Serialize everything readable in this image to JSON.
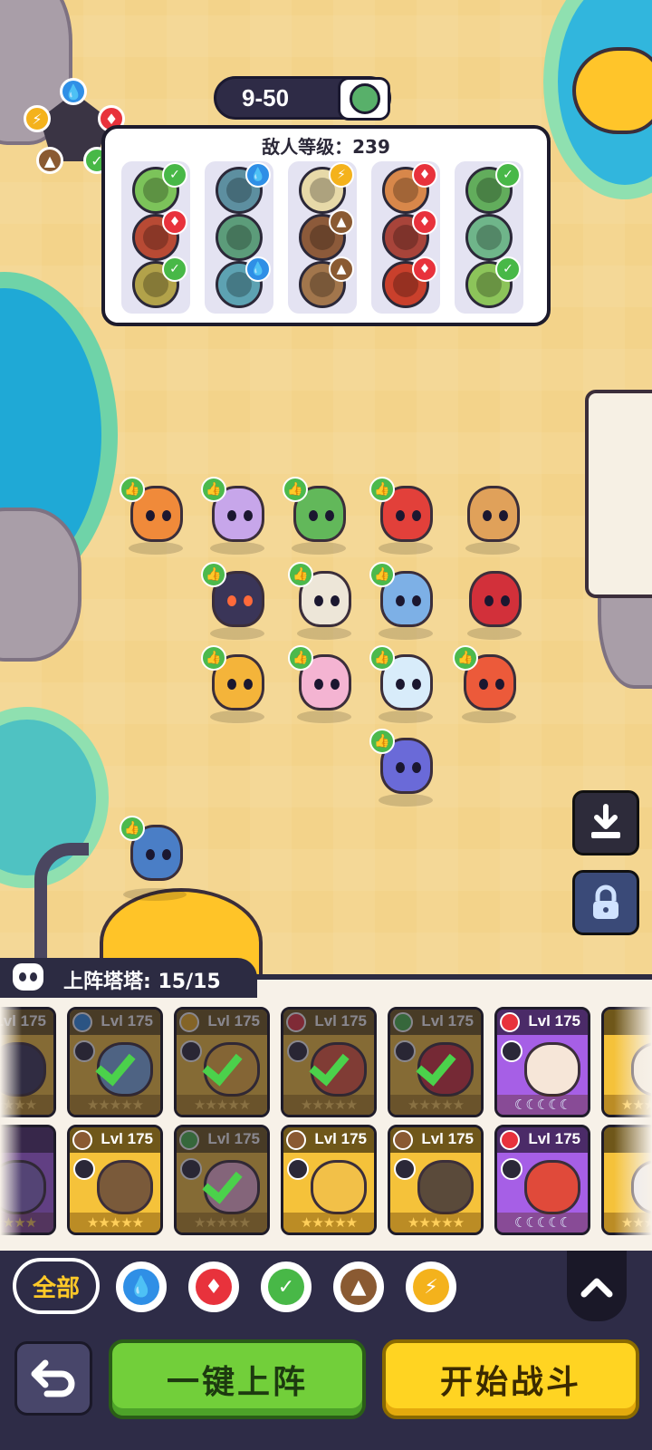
{
  "stage": {
    "label": "9-50"
  },
  "enemy_panel": {
    "level_text": "敌人等级：239"
  },
  "roster": {
    "label": "上阵塔塔: 15/15",
    "level_label": "Lvl 175"
  },
  "filters": {
    "all_label": "全部",
    "items": [
      "water",
      "fire",
      "grass",
      "earth",
      "lightning"
    ]
  },
  "actions": {
    "deploy_label": "一键上阵",
    "start_label": "开始战斗"
  },
  "colors": {
    "water": "#2f8fe6",
    "fire": "#e8323c",
    "grass": "#48b847",
    "earth": "#8a5a32",
    "lightning": "#f4b21c",
    "deploy_green": "#72cf3a",
    "start_yellow": "#ffd422",
    "panel_navy": "#2e2c47"
  }
}
